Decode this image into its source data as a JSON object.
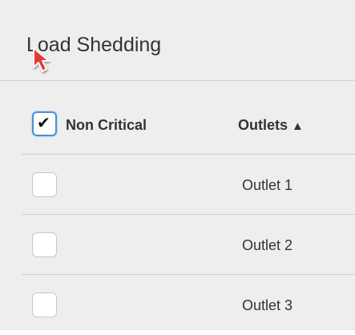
{
  "panel": {
    "title": "Load Shedding"
  },
  "table": {
    "headers": {
      "non_critical": "Non Critical",
      "outlets": "Outlets",
      "sort_indicator": "▲"
    },
    "select_all_checked": true,
    "rows": [
      {
        "name": "Outlet 1",
        "checked": false
      },
      {
        "name": "Outlet 2",
        "checked": false
      },
      {
        "name": "Outlet 3",
        "checked": false
      }
    ]
  },
  "icons": {
    "checkmark": "✔",
    "cursor": "mouse-pointer-icon"
  },
  "colors": {
    "focus_border": "#4a90d9",
    "cursor_fill": "#e53935",
    "panel_bg": "#eeeeee"
  }
}
